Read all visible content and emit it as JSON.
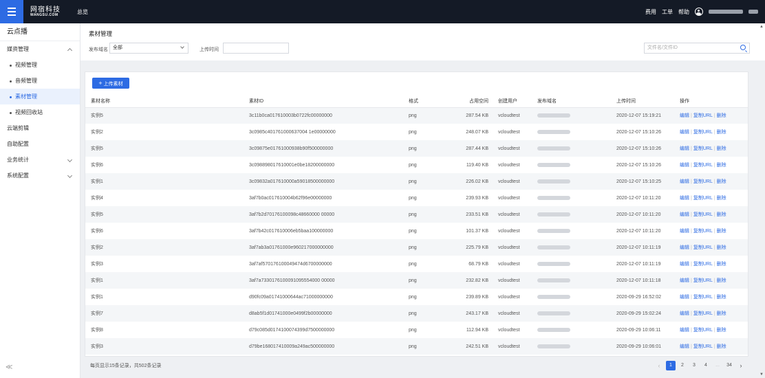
{
  "topbar": {
    "logo_cn": "网宿科技",
    "logo_en": "WANGSU.COM",
    "overview": "总览",
    "links": [
      "费用",
      "工单",
      "帮助"
    ]
  },
  "sidebar": {
    "title": "云点播",
    "items": [
      {
        "label": "媒资管理",
        "expanded": true
      },
      {
        "label": "视频管理",
        "sub": true
      },
      {
        "label": "音频管理",
        "sub": true
      },
      {
        "label": "素材管理",
        "sub": true,
        "active": true
      },
      {
        "label": "视频回收站",
        "sub": true
      },
      {
        "label": "云端剪辑"
      },
      {
        "label": "自助配置"
      },
      {
        "label": "业务统计",
        "chevron": true
      },
      {
        "label": "系统配置",
        "chevron": true
      }
    ],
    "collapse": "≪"
  },
  "header": {
    "title": "素材管理",
    "domain_label": "发布域名",
    "domain_value": "全部",
    "time_label": "上传时间",
    "search_placeholder": "文件名/文件ID"
  },
  "upload_button": "上传素材",
  "table": {
    "columns": [
      "素材名称",
      "素材ID",
      "格式",
      "占用空间",
      "创建用户",
      "发布域名",
      "上传时间",
      "操作"
    ],
    "ops": [
      "编辑",
      "复制URL",
      "删除"
    ],
    "rows": [
      {
        "name": "实例5",
        "id": "3c11b0ca017610003b0722fc00000000",
        "format": "png",
        "size": "287.54 KB",
        "user": "vcloudtest",
        "time": "2020-12-07 15:19:21"
      },
      {
        "name": "实例2",
        "id": "3c0985c401761000637004 1e00000000",
        "format": "png",
        "size": "248.07 KB",
        "user": "vcloudtest",
        "time": "2020-12-07 15:10:26"
      },
      {
        "name": "实例5",
        "id": "3c09875e01761000938b90f500000000",
        "format": "png",
        "size": "287.44 KB",
        "user": "vcloudtest",
        "time": "2020-12-07 15:10:26"
      },
      {
        "name": "实例6",
        "id": "3c098898017610001e0be18200000000",
        "format": "png",
        "size": "119.40 KB",
        "user": "vcloudtest",
        "time": "2020-12-07 15:10:26"
      },
      {
        "name": "实例1",
        "id": "3c09832a017610000a59018500000000",
        "format": "png",
        "size": "226.02 KB",
        "user": "vcloudtest",
        "time": "2020-12-07 15:10:25"
      },
      {
        "name": "实例4",
        "id": "3af7b0ac017610004b62f96e00000000",
        "format": "png",
        "size": "239.93 KB",
        "user": "vcloudtest",
        "time": "2020-12-07 10:11:20"
      },
      {
        "name": "实例5",
        "id": "3af7b2d70176100098c48660000 00000",
        "format": "png",
        "size": "233.51 KB",
        "user": "vcloudtest",
        "time": "2020-12-07 10:11:20"
      },
      {
        "name": "实例6",
        "id": "3af7b42c017610006eb5baa100000000",
        "format": "png",
        "size": "101.37 KB",
        "user": "vcloudtest",
        "time": "2020-12-07 10:11:20"
      },
      {
        "name": "实例2",
        "id": "3af7ab3a01761000e960217000000000",
        "format": "png",
        "size": "225.79 KB",
        "user": "vcloudtest",
        "time": "2020-12-07 10:11:19"
      },
      {
        "name": "实例3",
        "id": "3af7af570176100049474d6700000000",
        "format": "png",
        "size": "68.79 KB",
        "user": "vcloudtest",
        "time": "2020-12-07 10:11:19"
      },
      {
        "name": "实例1",
        "id": "3af7a7330176100091095554000 00000",
        "format": "png",
        "size": "232.82 KB",
        "user": "vcloudtest",
        "time": "2020-12-07 10:11:18"
      },
      {
        "name": "实例1",
        "id": "d90fc09a01741000644ac71000000000",
        "format": "png",
        "size": "239.89 KB",
        "user": "vcloudtest",
        "time": "2020-09-29 16:52:02"
      },
      {
        "name": "实例7",
        "id": "d8ab5f1d01741000e0499f2b00000000",
        "format": "png",
        "size": "243.17 KB",
        "user": "vcloudtest",
        "time": "2020-09-29 15:02:24"
      },
      {
        "name": "实例8",
        "id": "d79c085d0174100074399d7500000000",
        "format": "png",
        "size": "112.94 KB",
        "user": "vcloudtest",
        "time": "2020-09-29 10:06:11"
      },
      {
        "name": "实例3",
        "id": "d79be168017410009a249ac500000000",
        "format": "png",
        "size": "242.51 KB",
        "user": "vcloudtest",
        "time": "2020-09-29 10:06:01"
      }
    ]
  },
  "footer": {
    "info": "每页显示15条记录，共502条记录",
    "pages": [
      "1",
      "2",
      "3",
      "4",
      "...",
      "34"
    ],
    "current": "1",
    "prev": "‹",
    "next": "›"
  }
}
